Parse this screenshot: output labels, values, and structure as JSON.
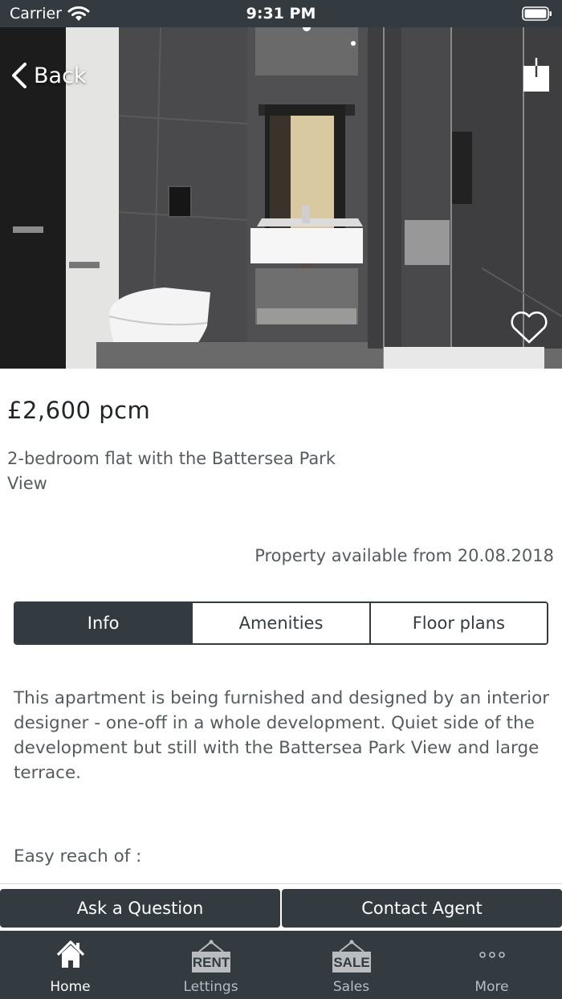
{
  "status_bar": {
    "carrier": "Carrier",
    "time": "9:31 PM"
  },
  "hero": {
    "back_label": "Back",
    "icons": {
      "back": "chevron-left-icon",
      "share": "share-icon",
      "favorite": "heart-icon"
    }
  },
  "listing": {
    "price": "£2,600 pcm",
    "title": "2-bedroom flat with the Battersea Park View",
    "available": "Property available from 20.08.2018",
    "description": "This apartment is being furnished and designed by an interior designer - one-off in a whole development. Quiet side of the development but still with the Battersea Park View and large terrace.",
    "reach_label": "Easy reach of :"
  },
  "tabs": [
    {
      "label": "Info",
      "active": true
    },
    {
      "label": "Amenities",
      "active": false
    },
    {
      "label": "Floor plans",
      "active": false
    }
  ],
  "actions": {
    "ask": "Ask a Question",
    "contact": "Contact Agent"
  },
  "tabbar": [
    {
      "label": "Home",
      "icon": "home-icon",
      "active": true
    },
    {
      "label": "Lettings",
      "icon": "rent-sign-icon",
      "sign": "RENT",
      "active": false
    },
    {
      "label": "Sales",
      "icon": "sale-sign-icon",
      "sign": "SALE",
      "active": false
    },
    {
      "label": "More",
      "icon": "more-dots-icon",
      "active": false
    }
  ],
  "colors": {
    "primary": "#333b40",
    "text_muted": "#555c60",
    "background": "#ffffff"
  }
}
